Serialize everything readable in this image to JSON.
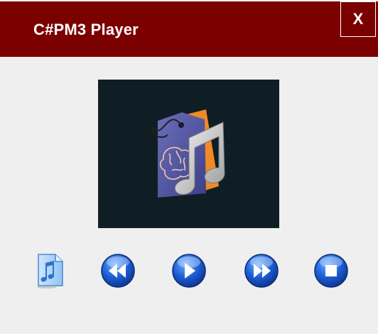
{
  "window": {
    "title": "C#PM3 Player",
    "close_label": "X"
  },
  "colors": {
    "titlebar": "#7b0000",
    "background": "#efefef",
    "artwork_background": "#0f1e24"
  },
  "artwork": {
    "icon": "music-tag-brain-icon"
  },
  "controls": [
    {
      "name": "playlist",
      "icon": "music-file-icon"
    },
    {
      "name": "rewind",
      "icon": "rewind-icon"
    },
    {
      "name": "play",
      "icon": "play-icon"
    },
    {
      "name": "fast-forward",
      "icon": "fast-forward-icon"
    },
    {
      "name": "stop",
      "icon": "stop-icon"
    }
  ]
}
